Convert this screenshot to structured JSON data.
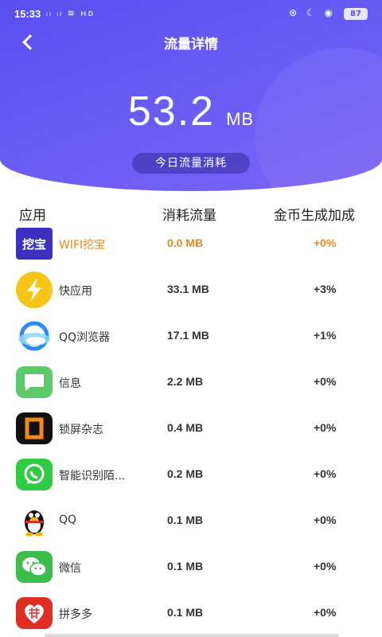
{
  "status_bar": {
    "time": "15:33",
    "left_icons": "ᵢₗ ᵢₗ ≋ ʜᴅ",
    "right_icons": "⊛ ☾ ◉",
    "battery": "87"
  },
  "nav": {
    "title": "流量详情"
  },
  "total": {
    "value": "53.2",
    "unit": "MB",
    "label": "今日流量消耗"
  },
  "table": {
    "headers": {
      "app": "应用",
      "usage": "消耗流量",
      "bonus": "金币生成加成"
    },
    "rows": [
      {
        "name": "WIFI挖宝",
        "usage": "0.0 MB",
        "bonus": "+0%",
        "icon": "wifi-treasure-icon",
        "icon_text": "挖宝"
      },
      {
        "name": "快应用",
        "usage": "33.1 MB",
        "bonus": "+3%",
        "icon": "quick-app-icon"
      },
      {
        "name": "QQ浏览器",
        "usage": "17.1 MB",
        "bonus": "+1%",
        "icon": "qq-browser-icon"
      },
      {
        "name": "信息",
        "usage": "2.2 MB",
        "bonus": "+0%",
        "icon": "messages-icon"
      },
      {
        "name": "锁屏杂志",
        "usage": "0.4 MB",
        "bonus": "+0%",
        "icon": "lock-screen-magazine-icon"
      },
      {
        "name": "智能识别陌...",
        "usage": "0.2 MB",
        "bonus": "+0%",
        "icon": "smart-caller-id-icon"
      },
      {
        "name": "QQ",
        "usage": "0.1 MB",
        "bonus": "+0%",
        "icon": "qq-penguin-icon"
      },
      {
        "name": "微信",
        "usage": "0.1 MB",
        "bonus": "+0%",
        "icon": "wechat-icon"
      },
      {
        "name": "拼多多",
        "usage": "0.1 MB",
        "bonus": "+0%",
        "icon": "pinduoduo-icon"
      }
    ]
  },
  "colors": {
    "header_gradient_start": "#5a4ef0",
    "header_gradient_end": "#7b63f7",
    "highlight": "#e38a1d"
  }
}
